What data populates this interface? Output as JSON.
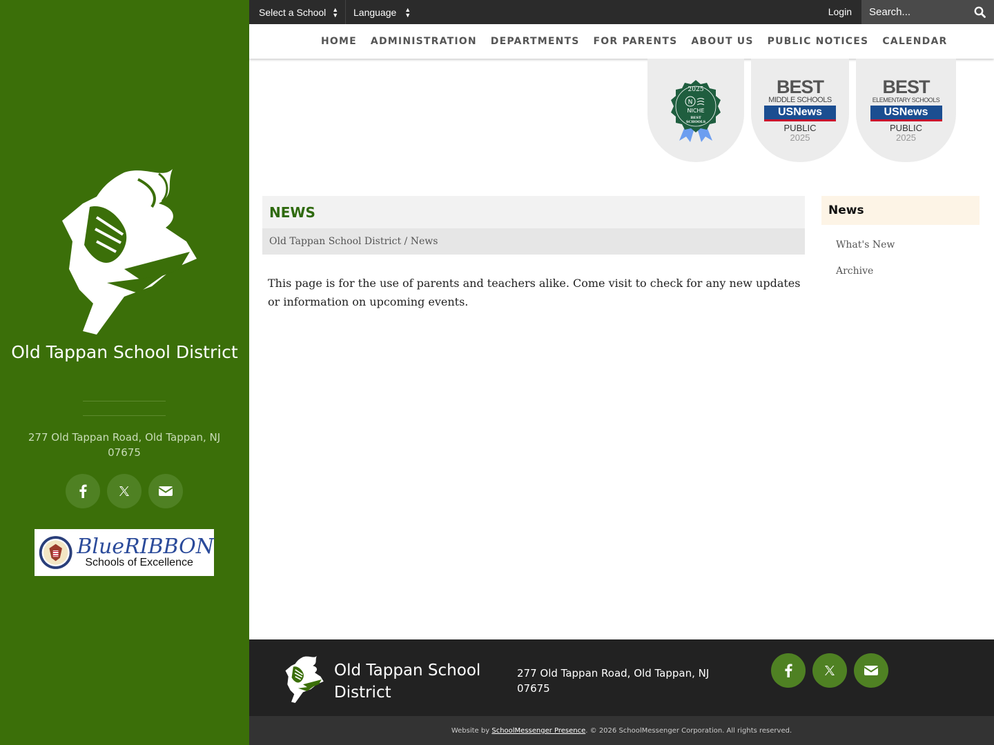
{
  "topbar": {
    "select_school": "Select a School",
    "language": "Language",
    "login": "Login",
    "search_placeholder": "Search..."
  },
  "nav": {
    "items": [
      "HOME",
      "ADMINISTRATION",
      "DEPARTMENTS",
      "FOR PARENTS",
      "ABOUT US",
      "PUBLIC NOTICES",
      "CALENDAR"
    ]
  },
  "sidebar": {
    "district_name": "Old Tappan School District",
    "address": "277 Old Tappan Road, Old Tappan, NJ 07675",
    "social": [
      "facebook-icon",
      "x-icon",
      "envelope-icon"
    ],
    "ribbon_title": "BlueRIBBON",
    "ribbon_subtitle": "Schools of Excellence"
  },
  "badges": {
    "niche": {
      "year": "2025",
      "brand": "NICHE",
      "text": "BEST SCHOOLS"
    },
    "middle": {
      "best": "BEST",
      "sub": "MIDDLE SCHOOLS",
      "brand": "USNews",
      "kind": "PUBLIC",
      "year": "2025"
    },
    "elementary": {
      "best": "BEST",
      "sub": "ELEMENTARY SCHOOLS",
      "brand": "USNews",
      "kind": "PUBLIC",
      "year": "2025"
    }
  },
  "main": {
    "title": "NEWS",
    "breadcrumb_root": "Old Tappan School District",
    "breadcrumb_sep": " / ",
    "breadcrumb_current": "News",
    "body": "This page is for the use of parents and teachers alike. Come visit to check for any new updates or information on upcoming events."
  },
  "subnav": {
    "heading": "News",
    "items": [
      "What's New",
      "Archive"
    ]
  },
  "footer": {
    "district_name": "Old Tappan School District",
    "address": "277 Old Tappan Road, Old Tappan, NJ 07675",
    "copyright_prefix": "Website by ",
    "copyright_link": "SchoolMessenger Presence",
    "copyright_suffix": ". © 2026 SchoolMessenger Corporation. All rights reserved."
  },
  "colors": {
    "sidebar_green": "#3b6f09",
    "title_green": "#2f6a0f",
    "topbar": "#2b2b2b",
    "footer": "#222222"
  }
}
